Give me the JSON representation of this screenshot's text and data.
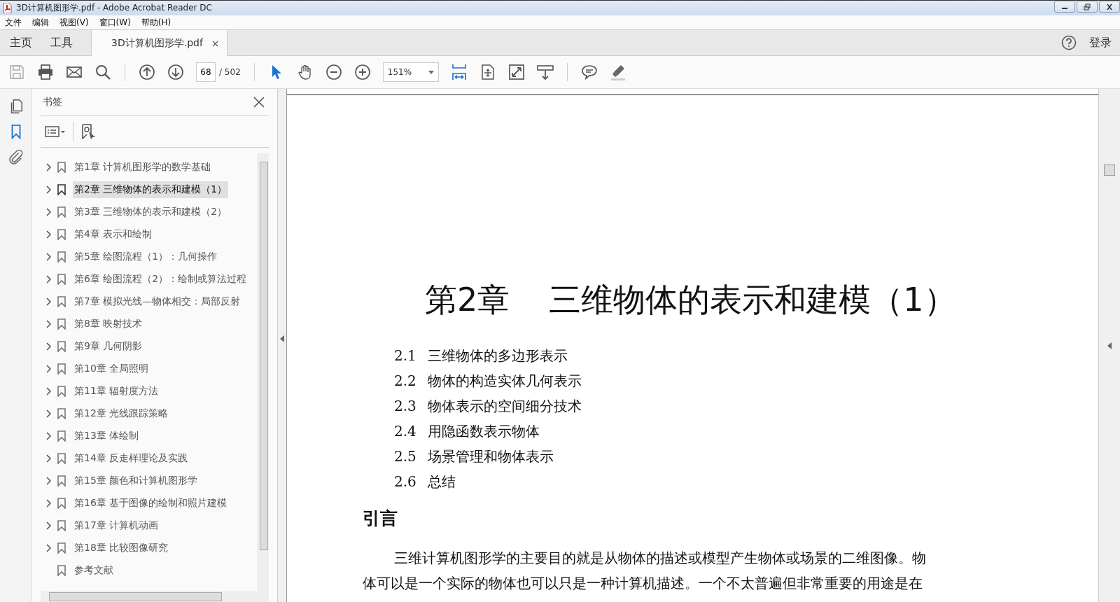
{
  "window": {
    "title": "3D计算机图形学.pdf - Adobe Acrobat Reader DC"
  },
  "menu": [
    "文件",
    "编辑",
    "视图(V)",
    "窗口(W)",
    "帮助(H)"
  ],
  "tabs": [
    {
      "label": "主页",
      "selected": false,
      "kind": "nav"
    },
    {
      "label": "工具",
      "selected": false,
      "kind": "nav"
    },
    {
      "label": "3D计算机图形学.pdf",
      "selected": true,
      "kind": "document",
      "close": "×"
    }
  ],
  "sign_in": "登录",
  "toolbar": {
    "page_number": "68",
    "page_total": "/ 502",
    "zoom": "151%"
  },
  "sidebar": {
    "title": "书签",
    "bookmarks": [
      {
        "label": "第1章 计算机图形学的数学基础",
        "selected": false,
        "has_children": true
      },
      {
        "label": "第2章 三维物体的表示和建模（1）",
        "selected": true,
        "has_children": true
      },
      {
        "label": "第3章 三维物体的表示和建模（2）",
        "selected": false,
        "has_children": true
      },
      {
        "label": "第4章 表示和绘制",
        "selected": false,
        "has_children": true
      },
      {
        "label": "第5章 绘图流程（1）：几何操作",
        "selected": false,
        "has_children": true
      },
      {
        "label": "第6章 绘图流程（2）：绘制或算法过程",
        "selected": false,
        "has_children": true
      },
      {
        "label": "第7章 模拟光线—物体相交：局部反射",
        "selected": false,
        "has_children": true
      },
      {
        "label": "第8章 映射技术",
        "selected": false,
        "has_children": true
      },
      {
        "label": "第9章 几何阴影",
        "selected": false,
        "has_children": true
      },
      {
        "label": "第10章 全局照明",
        "selected": false,
        "has_children": true
      },
      {
        "label": "第11章 辐射度方法",
        "selected": false,
        "has_children": true
      },
      {
        "label": "第12章 光线跟踪策略",
        "selected": false,
        "has_children": true
      },
      {
        "label": "第13章 体绘制",
        "selected": false,
        "has_children": true
      },
      {
        "label": "第14章 反走样理论及实践",
        "selected": false,
        "has_children": true
      },
      {
        "label": "第15章 颜色和计算机图形学",
        "selected": false,
        "has_children": true
      },
      {
        "label": "第16章 基于图像的绘制和照片建模",
        "selected": false,
        "has_children": true
      },
      {
        "label": "第17章 计算机动画",
        "selected": false,
        "has_children": true
      },
      {
        "label": "第18章 比较图像研究",
        "selected": false,
        "has_children": true
      },
      {
        "label": "参考文献",
        "selected": false,
        "has_children": false
      }
    ]
  },
  "document": {
    "chapter_number": "第2章",
    "chapter_title": "三维物体的表示和建模（1）",
    "toc": [
      {
        "number": "2.1",
        "title": "三维物体的多边形表示"
      },
      {
        "number": "2.2",
        "title": "物体的构造实体几何表示"
      },
      {
        "number": "2.3",
        "title": "物体表示的空间细分技术"
      },
      {
        "number": "2.4",
        "title": "用隐函数表示物体"
      },
      {
        "number": "2.5",
        "title": "场景管理和物体表示"
      },
      {
        "number": "2.6",
        "title": "总结"
      }
    ],
    "section_heading": "引言",
    "paragraph_lines": [
      "三维计算机图形学的主要目的就是从物体的描述或模型产生物体或场景的二维图像。物",
      "体可以是一个实际的物体也可以只是一种计算机描述。一个不太普遍但非常重要的用途是在"
    ]
  }
}
